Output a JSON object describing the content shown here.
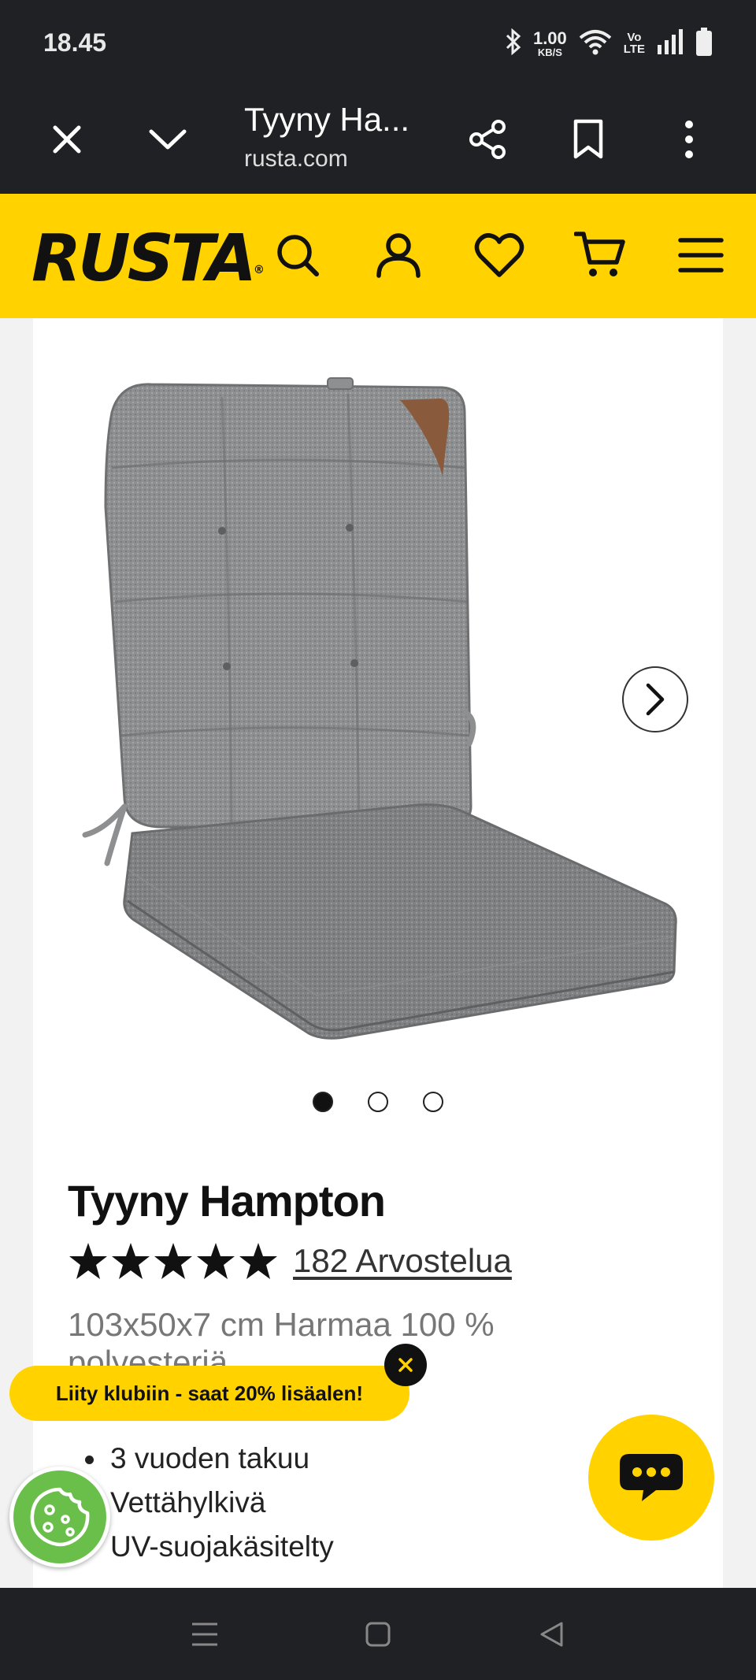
{
  "status_bar": {
    "time": "18.45",
    "net_speed_value": "1.00",
    "net_speed_unit": "KB/S",
    "volte_top": "Vo",
    "volte_bottom": "LTE",
    "icons": [
      "bluetooth-icon",
      "wifi-icon",
      "signal-icon",
      "battery-icon"
    ]
  },
  "browser": {
    "tab_title": "Tyyny Ha...",
    "url": "rusta.com",
    "icons": [
      "close-icon",
      "chevron-down-icon",
      "share-icon",
      "bookmark-icon",
      "more-vert-icon"
    ]
  },
  "header": {
    "logo_text": "RUSTA",
    "logo_mark": "®",
    "accent_color": "#ffd200",
    "icons": [
      "search-icon",
      "account-icon",
      "heart-icon",
      "cart-icon",
      "menu-icon"
    ]
  },
  "product": {
    "title": "Tyyny Hampton",
    "rating": 5,
    "rating_max": 5,
    "reviews_label": "182 Arvostelua",
    "subtitle": "103x50x7 cm Harmaa 100 %",
    "subtitle_cut": "polyesteriä",
    "image_count": 3,
    "image_active_index": 0,
    "features": [
      "3 vuoden takuu",
      "Vettähylkivä",
      "UV-suojakäsitelty"
    ]
  },
  "club_banner": {
    "label": "Liity klubiin - saat 20% lisäalen!"
  },
  "floating": {
    "chat_icon": "chat-icon",
    "cookie_icon": "cookie-icon"
  },
  "nav": {
    "icons": [
      "recent-apps-icon",
      "home-icon",
      "back-icon"
    ]
  }
}
